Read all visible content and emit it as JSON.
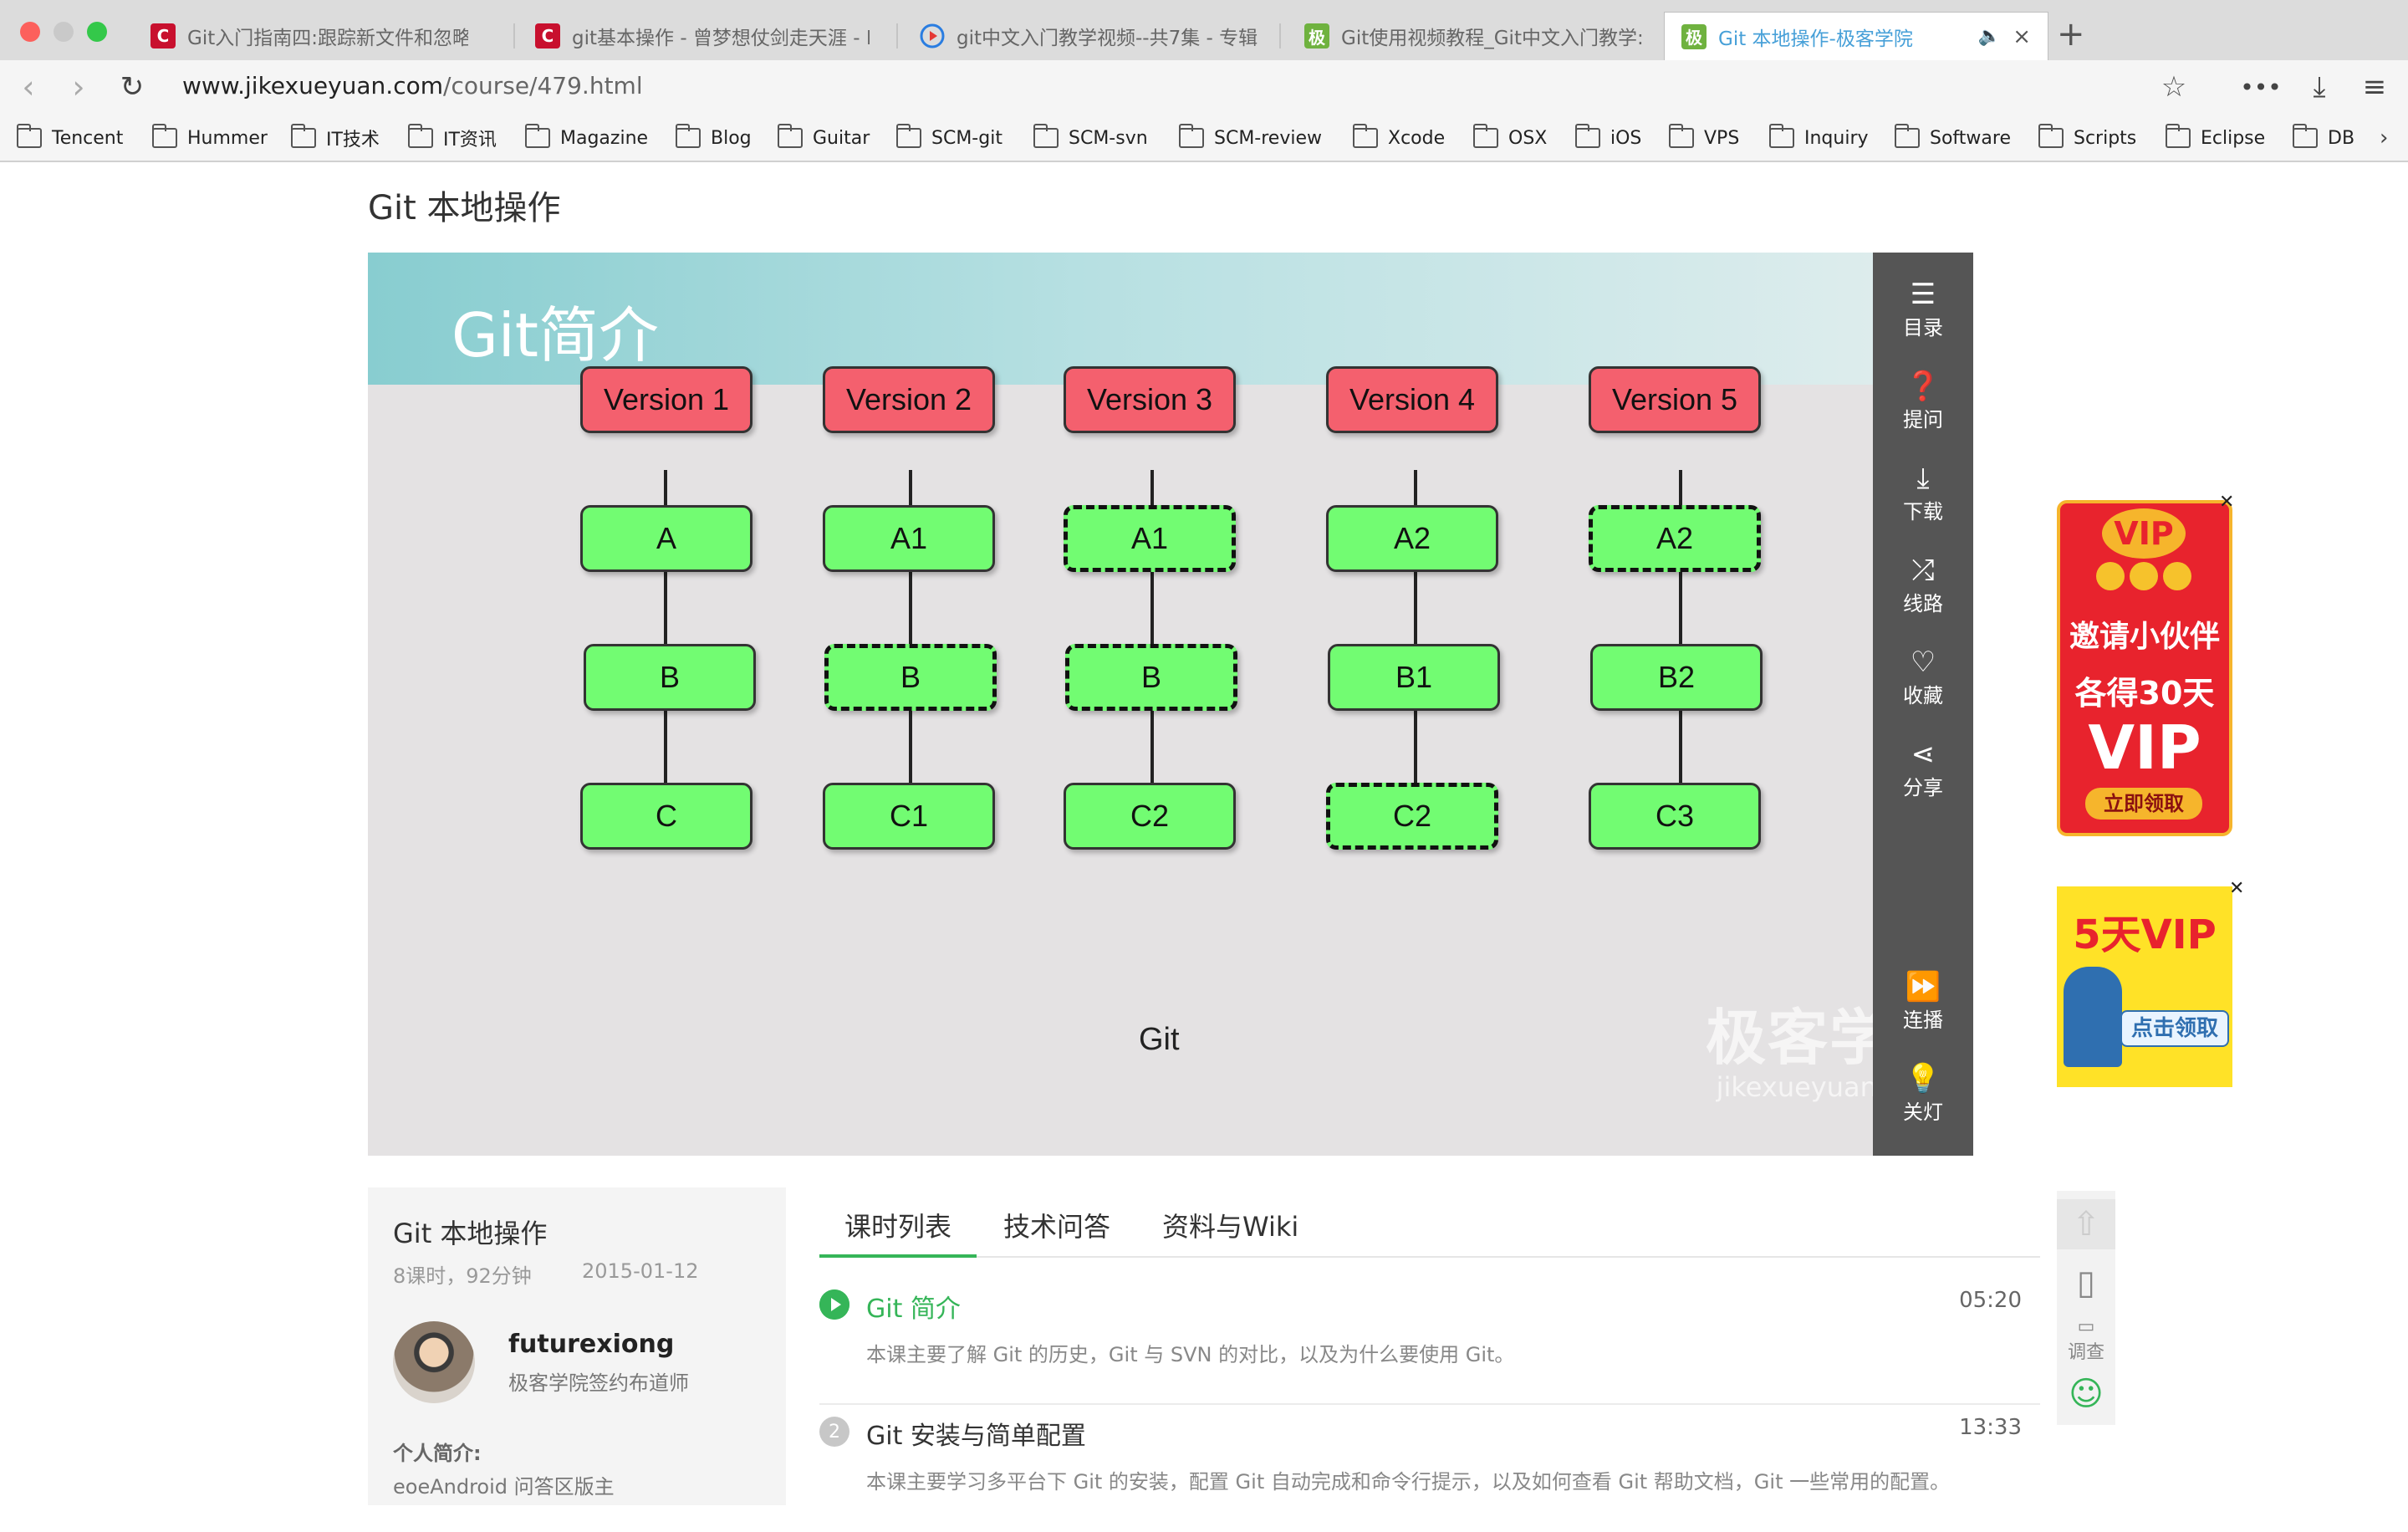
{
  "browser": {
    "tabs": [
      {
        "title": "Git入门指南四:跟踪新文件和忽略某",
        "icon": "csdn-icon",
        "color": "#c8102e"
      },
      {
        "title": "git基本操作 - 曾梦想仗剑走天涯 - I",
        "icon": "csdn-icon",
        "color": "#c8102e"
      },
      {
        "title": "git中文入门教学视频--共7集 - 专辑",
        "icon": "video-play-icon",
        "color": "#2a7de1"
      },
      {
        "title": "Git使用视频教程_Git中文入门教学:",
        "icon": "jikexueyuan-icon",
        "color": "#6fb23f"
      },
      {
        "title": "Git 本地操作-极客学院",
        "icon": "jikexueyuan-icon",
        "color": "#6fb23f",
        "active": true
      }
    ],
    "new_tab": "+",
    "url_domain": "www.jikexueyuan.com",
    "url_path": "/course/479.html",
    "bookmarks": [
      "Tencent",
      "Hummer",
      "IT技术",
      "IT资讯",
      "Magazine",
      "Blog",
      "Guitar",
      "SCM-git",
      "SCM-svn",
      "SCM-review",
      "Xcode",
      "OSX",
      "iOS",
      "VPS",
      "Inquiry",
      "Software",
      "Scripts",
      "Eclipse",
      "DB"
    ]
  },
  "page": {
    "title": "Git 本地操作"
  },
  "video": {
    "slide_title": "Git简介",
    "versions": [
      {
        "label": "Version 1",
        "nodes": [
          {
            "label": "A",
            "dashed": false
          },
          {
            "label": "B",
            "dashed": false
          },
          {
            "label": "C",
            "dashed": false
          }
        ]
      },
      {
        "label": "Version 2",
        "nodes": [
          {
            "label": "A1",
            "dashed": false
          },
          {
            "label": "B",
            "dashed": true
          },
          {
            "label": "C1",
            "dashed": false
          }
        ]
      },
      {
        "label": "Version 3",
        "nodes": [
          {
            "label": "A1",
            "dashed": true
          },
          {
            "label": "B",
            "dashed": true
          },
          {
            "label": "C2",
            "dashed": false
          }
        ]
      },
      {
        "label": "Version 4",
        "nodes": [
          {
            "label": "A2",
            "dashed": false
          },
          {
            "label": "B1",
            "dashed": false
          },
          {
            "label": "C2",
            "dashed": true
          }
        ]
      },
      {
        "label": "Version 5",
        "nodes": [
          {
            "label": "A2",
            "dashed": true
          },
          {
            "label": "B2",
            "dashed": false
          },
          {
            "label": "C3",
            "dashed": false
          }
        ]
      }
    ],
    "caption": "Git",
    "watermark_cn": "极客学院",
    "watermark_en": "jikexueyuan.com",
    "side_tools": [
      {
        "label": "目录",
        "icon": "list-icon"
      },
      {
        "label": "提问",
        "icon": "question-icon"
      },
      {
        "label": "下载",
        "icon": "download-icon"
      },
      {
        "label": "线路",
        "icon": "shuffle-icon"
      },
      {
        "label": "收藏",
        "icon": "heart-icon"
      },
      {
        "label": "分享",
        "icon": "share-icon"
      },
      {
        "label": "连播",
        "icon": "autoplay-icon"
      },
      {
        "label": "关灯",
        "icon": "bulb-icon"
      }
    ]
  },
  "ads": {
    "vip_top": "VIP",
    "invite_line1": "邀请小伙伴",
    "invite_line2": "各得30天",
    "invite_vip": "VIP",
    "invite_button": "立即领取",
    "five_day": "5天VIP",
    "click_claim": "点击领取"
  },
  "course": {
    "title": "Git 本地操作",
    "meta": "8课时，92分钟",
    "date": "2015-01-12",
    "teacher": "futurexiong",
    "teacher_role": "极客学院签约布道师",
    "bio_label": "个人简介:",
    "bio_text": "eoeAndroid 问答区版主"
  },
  "course_tabs": [
    "课时列表",
    "技术问答",
    "资料与Wiki"
  ],
  "lessons": [
    {
      "num": "",
      "title": "Git 简介",
      "duration": "05:20",
      "desc": "本课主要了解 Git 的历史，Git 与 SVN 的对比，以及为什么要使用 Git。",
      "playing": true
    },
    {
      "num": "2",
      "title": "Git 安装与简单配置",
      "duration": "13:33",
      "desc": "本课主要学习多平台下 Git 的安装，配置 Git 自动完成和命令行提示，以及如何查看 Git 帮助文档，Git 一些常用的配置。",
      "playing": false
    }
  ],
  "float_tools": {
    "survey": "调查"
  },
  "colors": {
    "accent_green": "#35b558",
    "version_red": "#f4606e",
    "node_green": "#72fc72"
  }
}
